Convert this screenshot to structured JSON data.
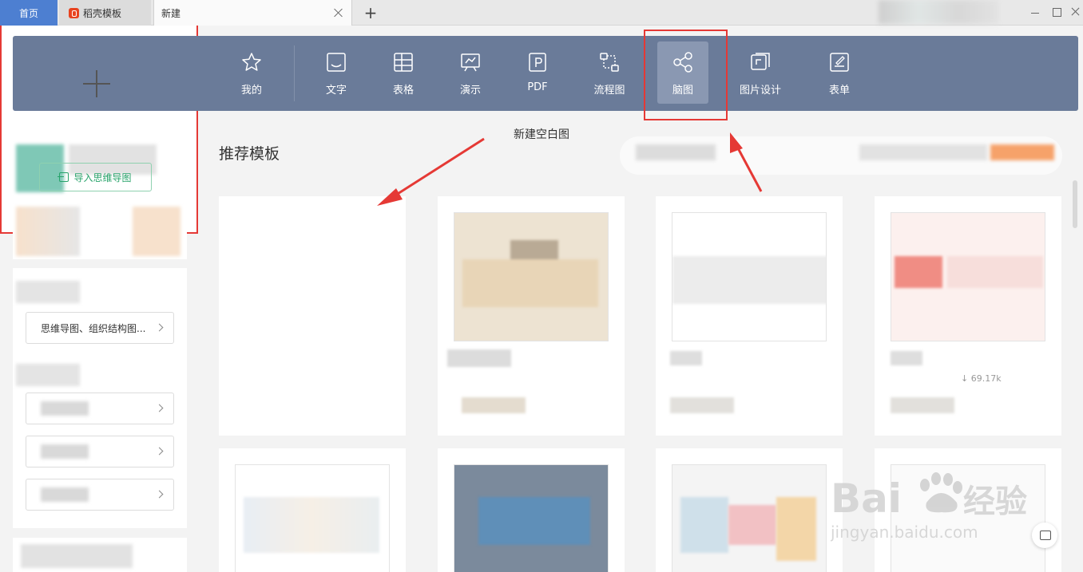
{
  "tabs": {
    "home": "首页",
    "docer": "稻壳模板",
    "new": "新建",
    "add": "+"
  },
  "typebar": {
    "items": [
      {
        "label": "我的",
        "icon": "star-icon"
      },
      {
        "label": "文字",
        "icon": "document-icon"
      },
      {
        "label": "表格",
        "icon": "spreadsheet-icon"
      },
      {
        "label": "演示",
        "icon": "presentation-icon"
      },
      {
        "label": "PDF",
        "icon": "pdf-icon"
      },
      {
        "label": "流程图",
        "icon": "flowchart-icon"
      },
      {
        "label": "脑图",
        "icon": "mindmap-icon",
        "active": true
      },
      {
        "label": "图片设计",
        "icon": "image-design-icon"
      },
      {
        "label": "表单",
        "icon": "form-icon"
      }
    ]
  },
  "sidebar": {
    "category_button": "思维导图、组织结构图..."
  },
  "main": {
    "section_title": "推荐模板",
    "blank_card": {
      "label": "新建空白图",
      "import_button": "导入思维导图"
    },
    "download_count": "69.17k"
  },
  "watermark": {
    "brand": "Bai du 经验",
    "url": "jingyan.baidu.com"
  },
  "colors": {
    "toolbar_bg": "#6a7b99",
    "active_tab_bg": "#4d7fd1",
    "annotation_red": "#e53935",
    "import_green": "#27a36a"
  }
}
